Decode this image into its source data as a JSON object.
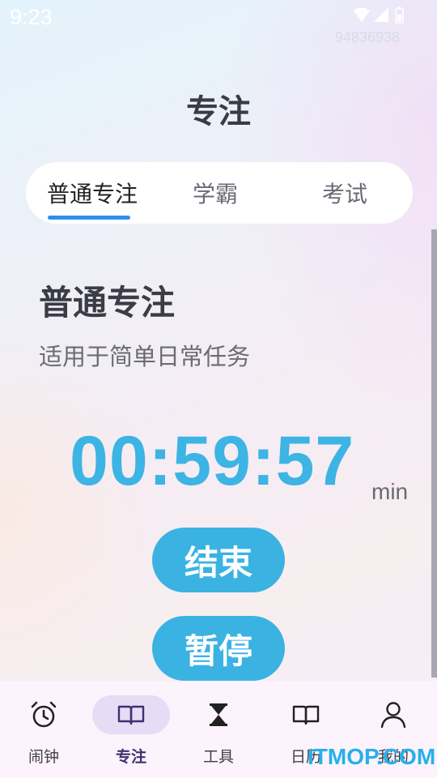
{
  "status_bar": {
    "time": "9:23",
    "device_id": "94836938",
    "icons": [
      "wifi-icon",
      "signal-icon",
      "battery-icon"
    ]
  },
  "header": {
    "title": "专注"
  },
  "tabs": [
    {
      "label": "普通专注",
      "active": true
    },
    {
      "label": "学霸",
      "active": false
    },
    {
      "label": "考试",
      "active": false
    }
  ],
  "mode": {
    "title": "普通专注",
    "description": "适用于简单日常任务"
  },
  "timer": {
    "value": "00:59:57",
    "unit": "min"
  },
  "buttons": {
    "end_label": "结束",
    "pause_label": "暂停"
  },
  "bottom_nav": [
    {
      "label": "闹钟",
      "icon": "alarm-clock-icon",
      "active": false
    },
    {
      "label": "专注",
      "icon": "book-icon",
      "active": true
    },
    {
      "label": "工具",
      "icon": "hourglass-icon",
      "active": false
    },
    {
      "label": "日历",
      "icon": "book-icon",
      "active": false
    },
    {
      "label": "我的",
      "icon": "person-icon",
      "active": false
    }
  ],
  "watermark": "ITMOP.COM",
  "colors": {
    "accent": "#3ab3e3",
    "tab_indicator": "#2f8ef0",
    "nav_active_bg": "#e6dcf5"
  }
}
